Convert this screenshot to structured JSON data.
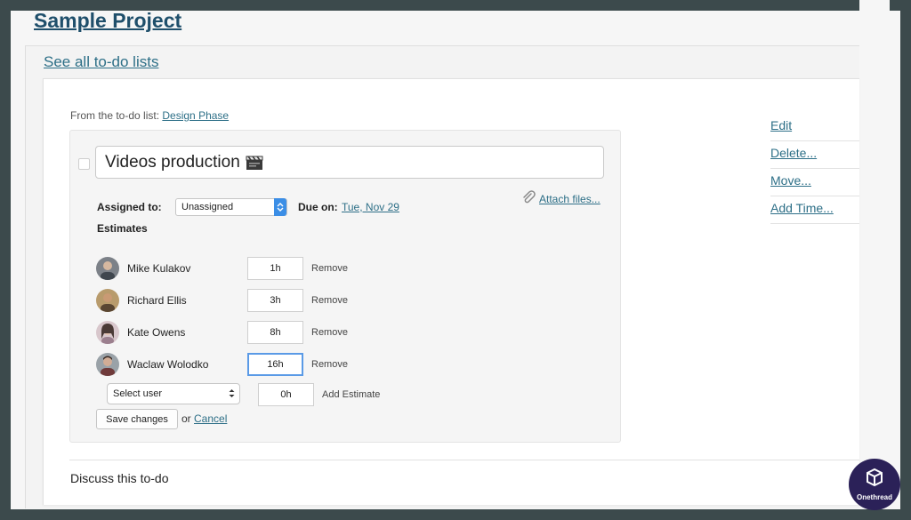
{
  "project": {
    "title": "Sample Project"
  },
  "nav": {
    "see_all_label": "See all to-do lists"
  },
  "todo": {
    "from_prefix": "From the to-do list:",
    "list_name": "Design Phase",
    "title": "Videos production",
    "title_emoji": "clapperboard-icon",
    "assigned_label": "Assigned to:",
    "assigned_value": "Unassigned",
    "due_label": "Due on:",
    "due_value": "Tue, Nov 29",
    "attach_label": "Attach files..."
  },
  "estimates": {
    "title": "Estimates",
    "rows": [
      {
        "name": "Mike Kulakov",
        "hours": "1h",
        "action": "Remove"
      },
      {
        "name": "Richard Ellis",
        "hours": "3h",
        "action": "Remove"
      },
      {
        "name": "Kate Owens",
        "hours": "8h",
        "action": "Remove"
      },
      {
        "name": "Waclaw Wolodko",
        "hours": "16h",
        "action": "Remove"
      }
    ],
    "new_row": {
      "select_placeholder": "Select user",
      "hours": "0h",
      "action": "Add Estimate"
    }
  },
  "form": {
    "save_label": "Save changes",
    "or_text": "or",
    "cancel_label": "Cancel"
  },
  "discuss": {
    "label": "Discuss this to-do"
  },
  "side_menu": [
    "Edit",
    "Delete...",
    "Move...",
    "Add Time..."
  ],
  "branding": {
    "badge_text": "Onethread"
  },
  "colors": {
    "link": "#2d6f87",
    "title": "#1f4f6b",
    "select_accent": "#3b8ee6",
    "focus_border": "#5a9ae6",
    "frame": "#3c4a4c",
    "badge_bg": "#2b2158"
  }
}
